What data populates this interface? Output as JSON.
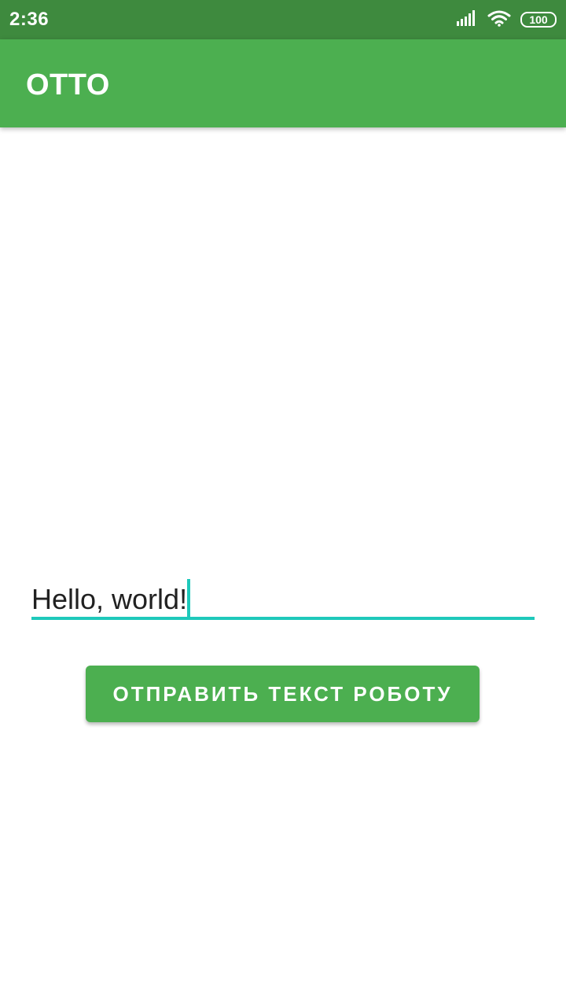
{
  "status_bar": {
    "time": "2:36",
    "battery_level": "100",
    "icons": [
      "signal-icon",
      "wifi-icon",
      "battery-icon"
    ],
    "background_color": "#3e8a3e"
  },
  "app_bar": {
    "title": "OTTO",
    "background_color": "#4caf50"
  },
  "main": {
    "text_input": {
      "value": "Hello, world!",
      "accent_color": "#1ec9bb"
    },
    "send_button": {
      "label": "ОТПРАВИТЬ ТЕКСТ РОБОТУ",
      "background_color": "#4caf50"
    }
  }
}
